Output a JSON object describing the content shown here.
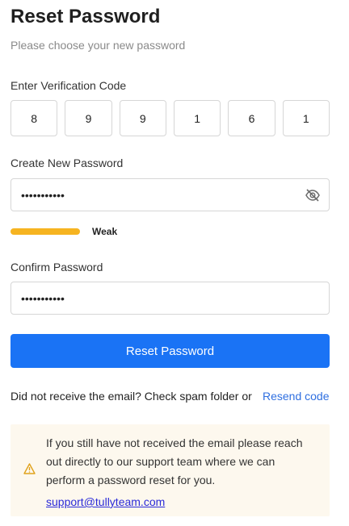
{
  "header": {
    "title": "Reset Password",
    "subtitle": "Please choose your new password"
  },
  "verification": {
    "label": "Enter Verification Code",
    "digits": [
      "8",
      "9",
      "9",
      "1",
      "6",
      "1"
    ]
  },
  "new_password": {
    "label": "Create New Password",
    "value_masked": "•••••••••••",
    "toggle_icon": "eye-off-icon",
    "strength": {
      "label": "Weak",
      "color": "#f6b421"
    }
  },
  "confirm_password": {
    "label": "Confirm Password",
    "value_masked": "•••••••••••"
  },
  "submit": {
    "label": "Reset Password",
    "color": "#1a73f5"
  },
  "resend": {
    "text": "Did not receive the email? Check spam folder or",
    "link": "Resend code"
  },
  "notice": {
    "icon": "warning-icon",
    "text": "If you still have not received the email please reach out directly to our support team where we can perform a password reset for you.",
    "email": "support@tullyteam.com"
  }
}
